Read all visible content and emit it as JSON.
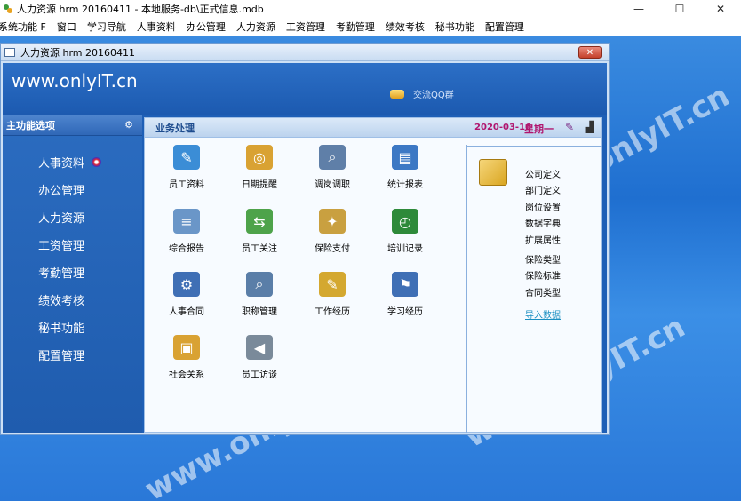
{
  "app": {
    "title": "人力资源 hrm 20160411 - 本地服务-db\\正式信息.mdb",
    "minimize": "—",
    "maximize": "☐",
    "close": "✕"
  },
  "menu": [
    "系统功能 F",
    "窗口",
    "学习导航",
    "人事资料",
    "办公管理",
    "人力资源",
    "工资管理",
    "考勤管理",
    "绩效考核",
    "秘书功能",
    "配置管理"
  ],
  "window": {
    "title": "人力资源 hrm 20160411",
    "close": "✕"
  },
  "banner": {
    "site": "www.onlyIT.cn",
    "qq": "交流QQ群"
  },
  "sidebar": {
    "header": "主功能选项",
    "items": [
      "人事资料",
      "办公管理",
      "人力资源",
      "工资管理",
      "考勤管理",
      "绩效考核",
      "秘书功能",
      "配置管理"
    ]
  },
  "main": {
    "header": "业务处理",
    "date": "2020-03-16",
    "weekday": "星期一",
    "tiles": [
      {
        "label": "员工资料",
        "icon": "employee-file-icon"
      },
      {
        "label": "日期提醒",
        "icon": "date-reminder-icon"
      },
      {
        "label": "调岗调职",
        "icon": "transfer-icon"
      },
      {
        "label": "统计报表",
        "icon": "report-icon"
      },
      {
        "label": "综合报告",
        "icon": "summary-report-icon"
      },
      {
        "label": "员工关注",
        "icon": "employee-care-icon"
      },
      {
        "label": "保险支付",
        "icon": "insurance-pay-icon"
      },
      {
        "label": "培训记录",
        "icon": "training-record-icon"
      },
      {
        "label": "人事合同",
        "icon": "contract-icon"
      },
      {
        "label": "职称管理",
        "icon": "title-manage-icon"
      },
      {
        "label": "工作经历",
        "icon": "work-history-icon"
      },
      {
        "label": "学习经历",
        "icon": "study-history-icon"
      },
      {
        "label": "社会关系",
        "icon": "social-relation-icon"
      },
      {
        "label": "员工访谈",
        "icon": "interview-icon"
      }
    ],
    "config": {
      "group1": [
        "公司定义",
        "部门定义",
        "岗位设置",
        "数据字典",
        "扩展属性"
      ],
      "group2": [
        "保险类型",
        "保险标准",
        "合同类型"
      ],
      "import": "导入数据"
    }
  },
  "watermark": "www.onlyIT.cn"
}
